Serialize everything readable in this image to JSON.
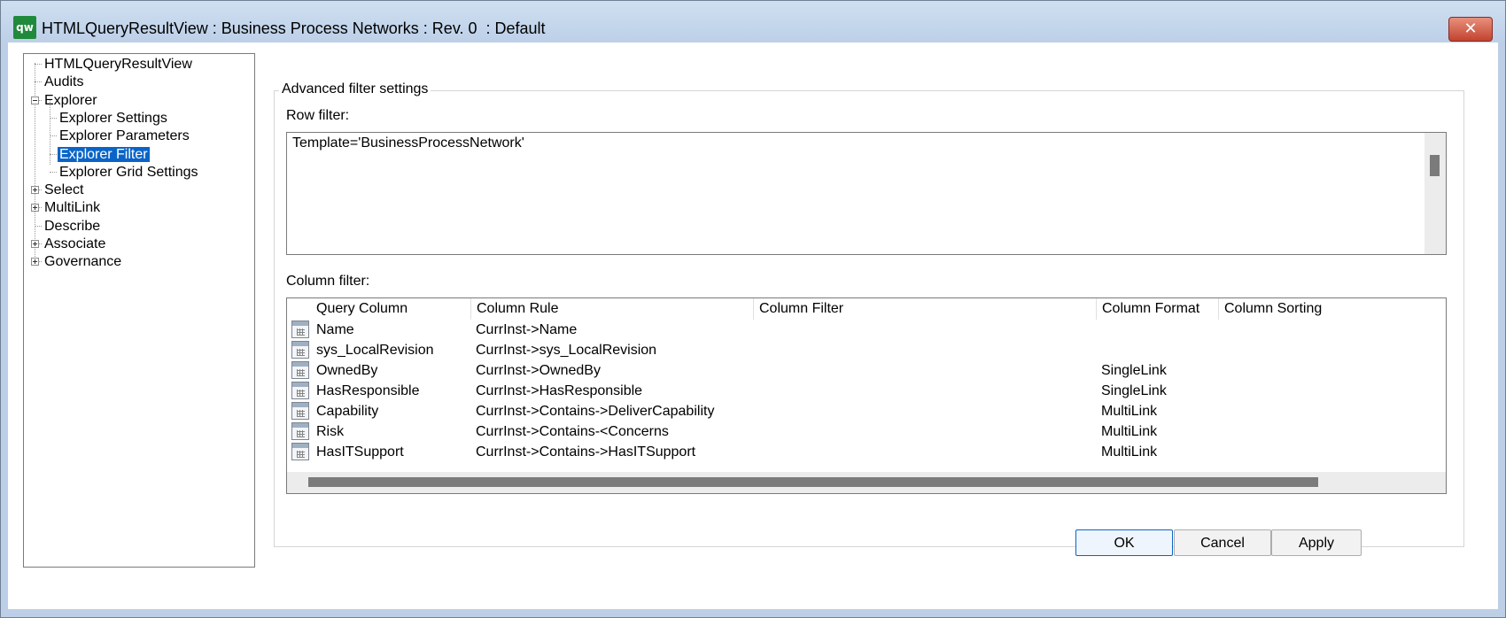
{
  "window": {
    "title": "HTMLQueryResultView : Business Process Networks : Rev. 0  : Default",
    "app_icon_text": "qw",
    "close_symbol": "✕"
  },
  "tree": {
    "items": [
      {
        "label": "HTMLQueryResultView",
        "level": 0,
        "expander": "none"
      },
      {
        "label": "Audits",
        "level": 0,
        "expander": "none"
      },
      {
        "label": "Explorer",
        "level": 0,
        "expander": "minus"
      },
      {
        "label": "Explorer Settings",
        "level": 1,
        "expander": "none"
      },
      {
        "label": "Explorer Parameters",
        "level": 1,
        "expander": "none"
      },
      {
        "label": "Explorer Filter",
        "level": 1,
        "expander": "none",
        "selected": true
      },
      {
        "label": "Explorer Grid Settings",
        "level": 1,
        "expander": "none"
      },
      {
        "label": "Select",
        "level": 0,
        "expander": "plus"
      },
      {
        "label": "MultiLink",
        "level": 0,
        "expander": "plus"
      },
      {
        "label": "Describe",
        "level": 0,
        "expander": "none"
      },
      {
        "label": "Associate",
        "level": 0,
        "expander": "plus"
      },
      {
        "label": "Governance",
        "level": 0,
        "expander": "plus"
      }
    ]
  },
  "filter_group": {
    "legend": "Advanced filter settings",
    "row_filter_label": "Row filter:",
    "row_filter_value": "Template='BusinessProcessNetwork'",
    "column_filter_label": "Column filter:"
  },
  "grid": {
    "headers": [
      "Query Column",
      "Column Rule",
      "Column Filter",
      "Column Format",
      "Column Sorting"
    ],
    "rows": [
      {
        "query": "Name",
        "rule": "CurrInst->Name",
        "filter": "",
        "format": "",
        "sorting": ""
      },
      {
        "query": "sys_LocalRevision",
        "rule": "CurrInst->sys_LocalRevision",
        "filter": "",
        "format": "",
        "sorting": ""
      },
      {
        "query": "OwnedBy",
        "rule": "CurrInst->OwnedBy",
        "filter": "",
        "format": "SingleLink",
        "sorting": ""
      },
      {
        "query": "HasResponsible",
        "rule": "CurrInst->HasResponsible",
        "filter": "",
        "format": "SingleLink",
        "sorting": ""
      },
      {
        "query": "Capability",
        "rule": "CurrInst->Contains->DeliverCapability",
        "filter": "",
        "format": "MultiLink",
        "sorting": ""
      },
      {
        "query": "Risk",
        "rule": "CurrInst->Contains-<Concerns",
        "filter": "",
        "format": "MultiLink",
        "sorting": ""
      },
      {
        "query": "HasITSupport",
        "rule": "CurrInst->Contains->HasITSupport",
        "filter": "",
        "format": "MultiLink",
        "sorting": ""
      }
    ]
  },
  "buttons": {
    "ok": "OK",
    "cancel": "Cancel",
    "apply": "Apply"
  }
}
